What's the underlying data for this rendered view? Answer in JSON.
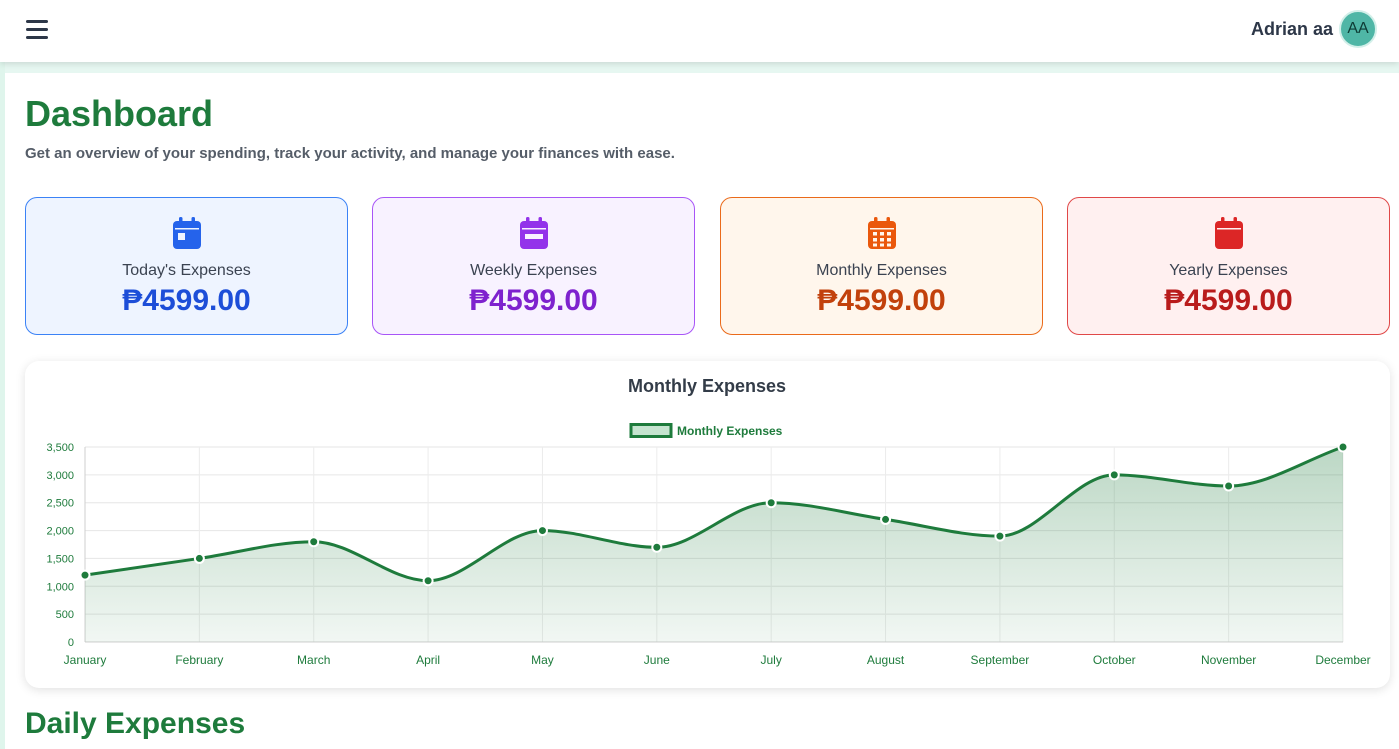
{
  "topbar": {
    "user_name": "Adrian aa",
    "avatar_initials": "AA",
    "menu_icon": "hamburger-menu-icon"
  },
  "page": {
    "title": "Dashboard",
    "subtitle": "Get an overview of your spending, track your activity, and manage your finances with ease."
  },
  "cards": [
    {
      "label": "Today's Expenses",
      "amount": "₱4599.00",
      "icon": "calendar-day-icon",
      "color": "#2563eb"
    },
    {
      "label": "Weekly Expenses",
      "amount": "₱4599.00",
      "icon": "calendar-week-icon",
      "color": "#9333ea"
    },
    {
      "label": "Monthly Expenses",
      "amount": "₱4599.00",
      "icon": "calendar-month-icon",
      "color": "#ea580c"
    },
    {
      "label": "Yearly Expenses",
      "amount": "₱4599.00",
      "icon": "calendar-icon",
      "color": "#dc2626"
    }
  ],
  "chart_data": {
    "type": "area",
    "title": "Monthly Expenses",
    "categories": [
      "January",
      "February",
      "March",
      "April",
      "May",
      "June",
      "July",
      "August",
      "September",
      "October",
      "November",
      "December"
    ],
    "series": [
      {
        "name": "Monthly Expenses",
        "values": [
          1200,
          1500,
          1800,
          1100,
          2000,
          1700,
          2500,
          2200,
          1900,
          3000,
          2800,
          3500
        ]
      }
    ],
    "ylim": [
      0,
      3500
    ],
    "yticks": [
      0,
      500,
      1000,
      1500,
      2000,
      2500,
      3000,
      3500
    ],
    "ytick_labels": [
      "0",
      "500",
      "1,000",
      "1,500",
      "2,000",
      "2,500",
      "3,000",
      "3,500"
    ],
    "grid": true,
    "legend": "top-center",
    "line_color": "#1e7b3c"
  },
  "daily": {
    "title": "Daily Expenses"
  }
}
